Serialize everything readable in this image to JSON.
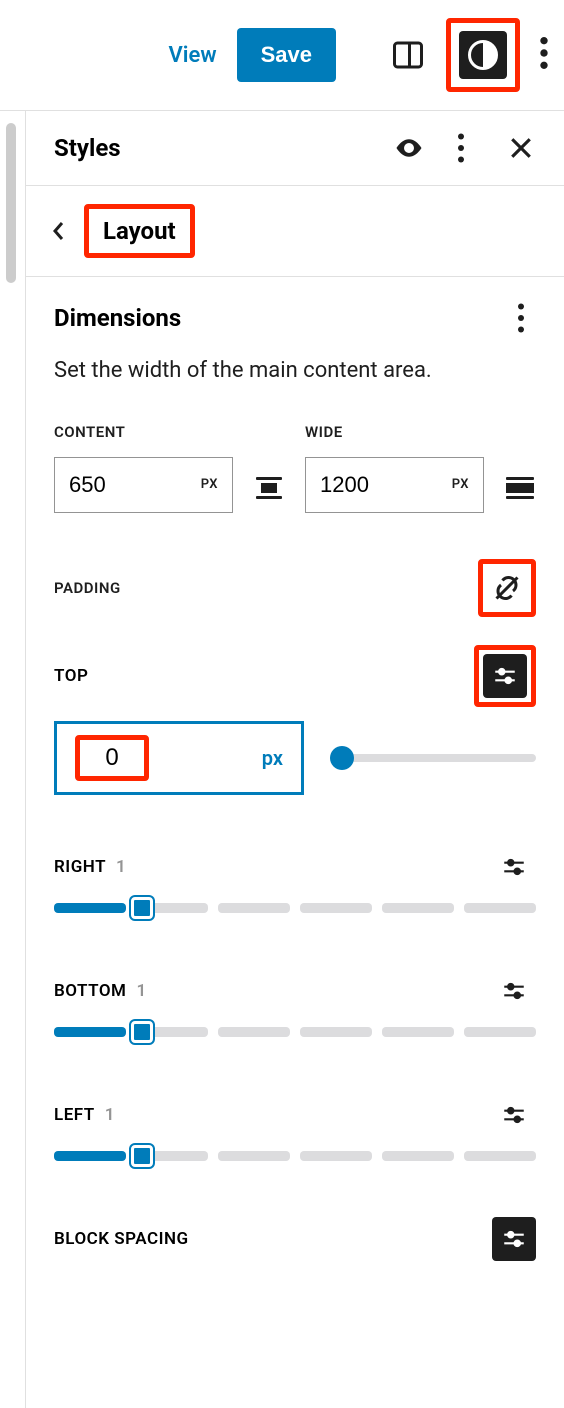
{
  "topbar": {
    "view": "View",
    "save": "Save"
  },
  "panel": {
    "title": "Styles",
    "subnav": "Layout"
  },
  "dimensions": {
    "heading": "Dimensions",
    "description": "Set the width of the main content area.",
    "content_label": "CONTENT",
    "content_value": "650",
    "content_unit": "PX",
    "wide_label": "WIDE",
    "wide_value": "1200",
    "wide_unit": "PX"
  },
  "padding": {
    "label": "PADDING",
    "top": {
      "label": "TOP",
      "value": "0",
      "unit": "px"
    },
    "right": {
      "label": "RIGHT",
      "value": "1"
    },
    "bottom": {
      "label": "BOTTOM",
      "value": "1"
    },
    "left": {
      "label": "LEFT",
      "value": "1"
    }
  },
  "block_spacing": {
    "label": "BLOCK SPACING"
  }
}
